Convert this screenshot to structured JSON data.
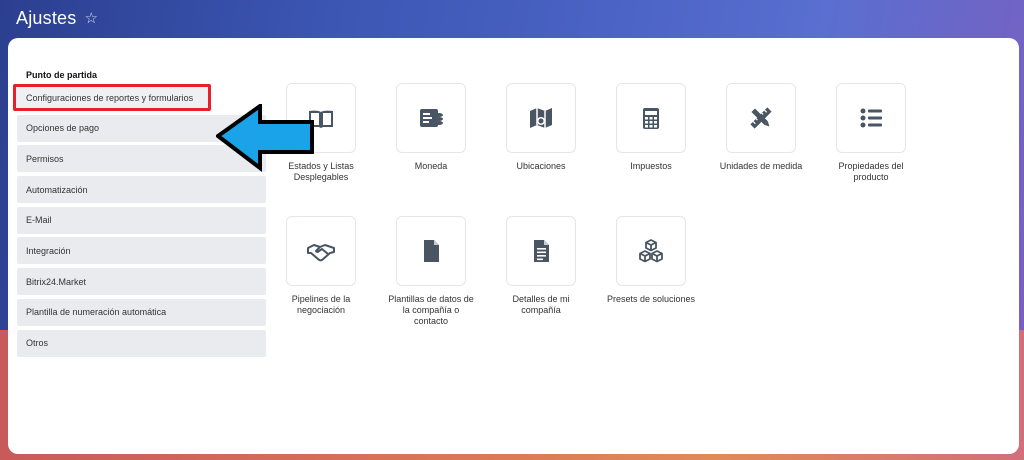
{
  "header": {
    "title": "Ajustes",
    "star_glyph": "☆"
  },
  "sidebar": {
    "heading": "Punto de partida",
    "items": [
      {
        "label": "Configuraciones de reportes y formularios",
        "highlighted": true
      },
      {
        "label": "Opciones de pago"
      },
      {
        "label": "Permisos"
      },
      {
        "label": "Automatización"
      },
      {
        "label": "E-Mail"
      },
      {
        "label": "Integración"
      },
      {
        "label": "Bitrix24.Market"
      },
      {
        "label": "Plantilla de numeración automática"
      },
      {
        "label": "Otros"
      }
    ]
  },
  "tiles": [
    {
      "label": "Estados y Listas Desplegables",
      "icon": "book-icon"
    },
    {
      "label": "Moneda",
      "icon": "currency-icon"
    },
    {
      "label": "Ubicaciones",
      "icon": "map-icon"
    },
    {
      "label": "Impuestos",
      "icon": "calculator-icon"
    },
    {
      "label": "Unidades de medida",
      "icon": "ruler-pencil-icon"
    },
    {
      "label": "Propiedades del producto",
      "icon": "list-icon"
    },
    {
      "label": "Pipelines de la negociación",
      "icon": "handshake-icon"
    },
    {
      "label": "Plantillas de datos de la compañía o contacto",
      "icon": "document-icon"
    },
    {
      "label": "Detalles de mi compañía",
      "icon": "text-document-icon"
    },
    {
      "label": "Presets de soluciones",
      "icon": "cubes-icon"
    }
  ],
  "colors": {
    "highlight_border": "#e8202a",
    "arrow_fill": "#1aa3e8",
    "icon": "#4a5563"
  }
}
